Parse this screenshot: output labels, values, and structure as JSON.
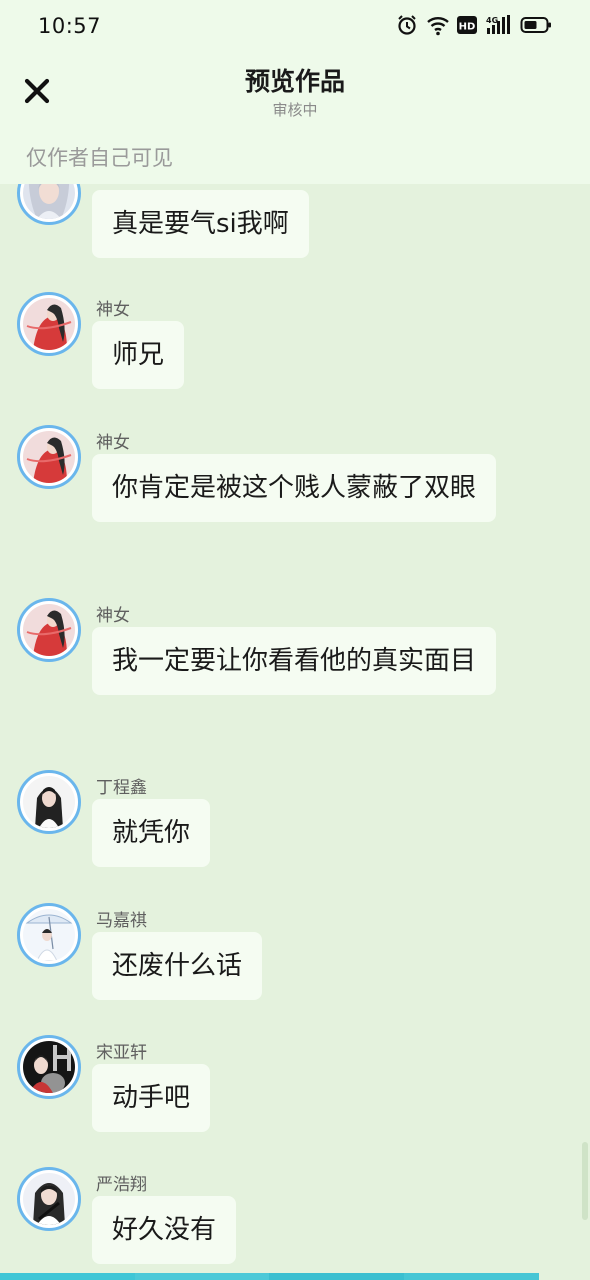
{
  "status": {
    "time": "10:57",
    "icons": [
      "alarm-icon",
      "wifi-icon",
      "hd-icon",
      "signal-4g-icon",
      "battery-icon"
    ]
  },
  "header": {
    "title": "预览作品",
    "subtitle": "审核中",
    "notice": "仅作者自己可见"
  },
  "colors": {
    "chat_background": "#e4f2dd",
    "header_background": "#eefaea",
    "bubble_background": "#f5fcf2",
    "avatar_border": "#6ab6ec",
    "bottom_strip": "#3fc6d6"
  },
  "messages": [
    {
      "sender": "",
      "text": "真是要气si我啊"
    },
    {
      "sender": "神女",
      "text": "师兄"
    },
    {
      "sender": "神女",
      "text": "你肯定是被这个贱人蒙蔽了双眼"
    },
    {
      "sender": "神女",
      "text": "我一定要让你看看他的真实面目"
    },
    {
      "sender": "丁程鑫",
      "text": "就凭你"
    },
    {
      "sender": "马嘉祺",
      "text": "还废什么话"
    },
    {
      "sender": "宋亚轩",
      "text": "动手吧"
    },
    {
      "sender": "严浩翔",
      "text": "好久没有"
    }
  ]
}
